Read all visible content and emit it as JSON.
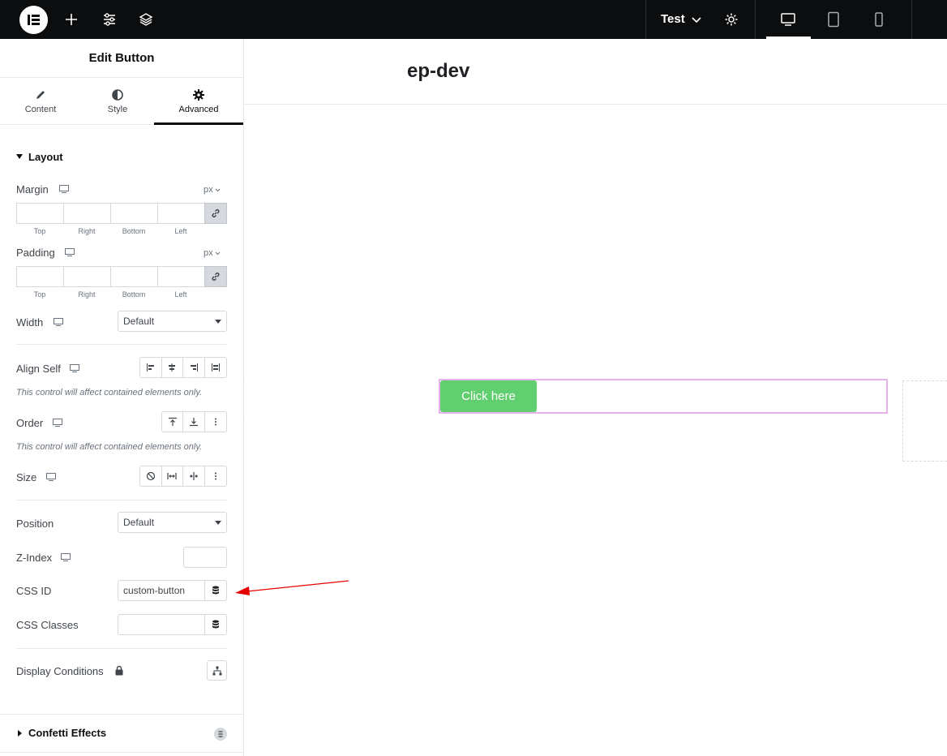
{
  "topbar": {
    "logo_icon": "elementor-logo-icon",
    "add_icon": "plus-icon",
    "settings_icon": "sliders-icon",
    "structure_icon": "layers-icon",
    "document_name": "Test",
    "dropdown_icon": "chevron-down-icon",
    "page_settings_icon": "gear-icon",
    "devices": [
      "desktop-icon",
      "tablet-icon",
      "mobile-icon"
    ],
    "active_device": "desktop"
  },
  "panel": {
    "title": "Edit Button",
    "tabs": [
      {
        "label": "Content",
        "icon": "pencil-icon"
      },
      {
        "label": "Style",
        "icon": "contrast-icon"
      },
      {
        "label": "Advanced",
        "icon": "gear-icon"
      }
    ],
    "active_tab": "Advanced",
    "layout": {
      "title": "Layout",
      "margin": {
        "label": "Margin",
        "unit": "px",
        "sides": [
          "Top",
          "Right",
          "Bottom",
          "Left"
        ]
      },
      "padding": {
        "label": "Padding",
        "unit": "px",
        "sides": [
          "Top",
          "Right",
          "Bottom",
          "Left"
        ]
      },
      "width": {
        "label": "Width",
        "value": "Default"
      },
      "align_self": {
        "label": "Align Self",
        "note": "This control will affect contained elements only."
      },
      "order": {
        "label": "Order",
        "note": "This control will affect contained elements only."
      },
      "size": {
        "label": "Size"
      },
      "position": {
        "label": "Position",
        "value": "Default"
      },
      "z_index": {
        "label": "Z-Index",
        "value": ""
      },
      "css_id": {
        "label": "CSS ID",
        "value": "custom-button"
      },
      "css_classes": {
        "label": "CSS Classes",
        "value": ""
      },
      "display_conditions": {
        "label": "Display Conditions"
      }
    },
    "confetti": {
      "title": "Confetti Effects"
    }
  },
  "canvas": {
    "site_title": "ep-dev",
    "button_text": "Click here",
    "button_color": "#61ce70"
  },
  "annotation": {
    "arrow_color": "#e60000"
  }
}
